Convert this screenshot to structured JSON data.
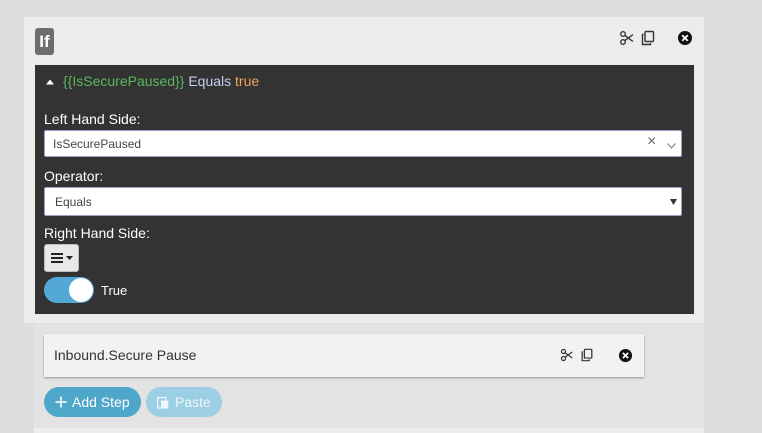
{
  "if_block": {
    "badge": "If",
    "condition": {
      "variable": "{{IsSecurePaused}}",
      "operator": "Equals",
      "value": "true",
      "lhs_label": "Left Hand Side:",
      "lhs_value": "IsSecurePaused",
      "lhs_clear": "×",
      "op_label": "Operator:",
      "op_value": "Equals",
      "rhs_label": "Right Hand Side:",
      "switch_label": "True",
      "switch_on": true
    }
  },
  "step": {
    "title": "Inbound.Secure Pause"
  },
  "buttons": {
    "add_step": "Add Step",
    "paste": "Paste"
  },
  "colors": {
    "condition_variable": "#5cb85c",
    "condition_operator": "#c8cdf2",
    "condition_value": "#f0a35a",
    "accent": "#4ea6c9"
  },
  "icons": {
    "cut": "scissors-icon",
    "copy": "copy-icon",
    "close": "close-circle-icon",
    "collapse": "caret-up-icon",
    "menu": "list-menu-icon",
    "add": "plus-icon",
    "paste": "paste-icon"
  }
}
